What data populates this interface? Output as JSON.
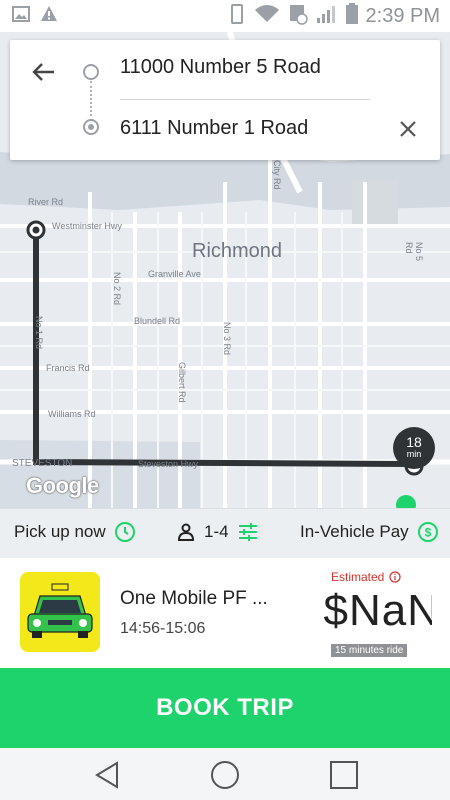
{
  "status_bar": {
    "time": "2:39 PM"
  },
  "route": {
    "origin": "11000 Number 5 Road",
    "destination": "6111 Number 1 Road"
  },
  "map": {
    "city_label": "Richmond",
    "street_labels": [
      "River Rd",
      "Westminster Hwy",
      "No 2 Rd",
      "Granville Ave",
      "Blundell Rd",
      "No 3 Rd",
      "No 1 Rd",
      "Francis Rd",
      "Gilbert Rd",
      "Williams Rd",
      "STEVESTON",
      "Steveston Hwy",
      "City Rd",
      "No 5 Rd"
    ],
    "attribution": "Google",
    "eta_value": "18",
    "eta_unit": "min",
    "route_color": "#2f3336"
  },
  "options": {
    "pickup": "Pick up now",
    "passengers": "1-4",
    "payment": "In-Vehicle Pay"
  },
  "vehicle": {
    "name": "One Mobile PF ...",
    "time_window": "14:56-15:06",
    "estimated_label": "Estimated",
    "price": "$NaN",
    "ride_badge": "15 minutes ride"
  },
  "book_button": "BOOK TRIP",
  "colors": {
    "accent": "#1ed36b",
    "estimated": "#d0342c"
  }
}
